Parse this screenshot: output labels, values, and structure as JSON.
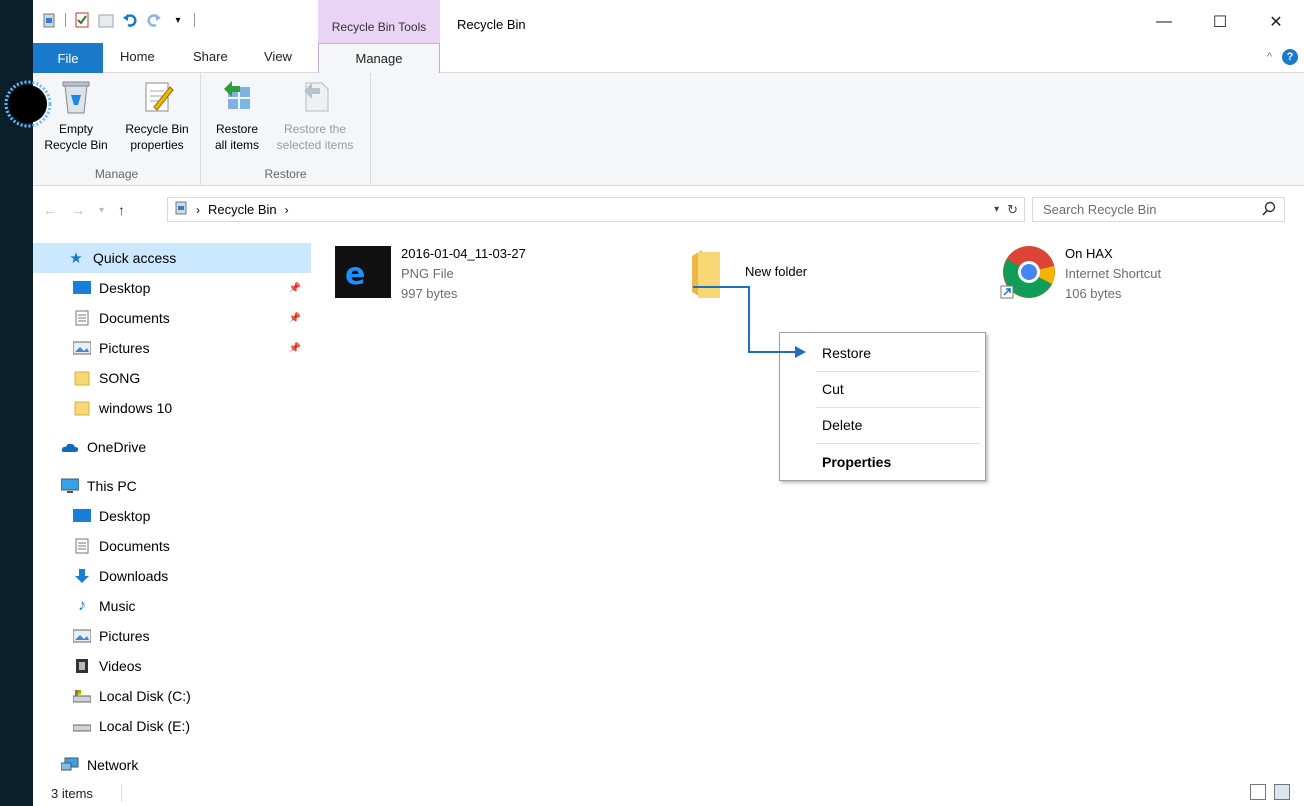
{
  "titlebar": {
    "context_tab_title": "Recycle Bin Tools",
    "window_title": "Recycle Bin",
    "minimize": "—",
    "maximize": "☐",
    "close": "✕"
  },
  "ribbon_tabs": {
    "file": "File",
    "home": "Home",
    "share": "Share",
    "view": "View",
    "manage": "Manage"
  },
  "ribbon": {
    "groups": {
      "manage": "Manage",
      "restore": "Restore"
    },
    "buttons": {
      "empty_line1": "Empty",
      "empty_line2": "Recycle Bin",
      "props_line1": "Recycle Bin",
      "props_line2": "properties",
      "restore_all_line1": "Restore",
      "restore_all_line2": "all items",
      "restore_sel_line1": "Restore the",
      "restore_sel_line2": "selected items"
    }
  },
  "address": {
    "path": "Recycle Bin",
    "search_placeholder": "Search Recycle Bin"
  },
  "nav": {
    "quick_access": "Quick access",
    "qa_desktop": "Desktop",
    "qa_documents": "Documents",
    "qa_pictures": "Pictures",
    "song": "SONG",
    "windows10": "windows 10",
    "onedrive": "OneDrive",
    "this_pc": "This PC",
    "pc_desktop": "Desktop",
    "pc_documents": "Documents",
    "pc_downloads": "Downloads",
    "pc_music": "Music",
    "pc_pictures": "Pictures",
    "pc_videos": "Videos",
    "local_c": "Local Disk (C:)",
    "local_e": "Local Disk (E:)",
    "network": "Network"
  },
  "files": [
    {
      "name": "2016-01-04_11-03-27",
      "type": "PNG File",
      "size": "997 bytes"
    },
    {
      "name": "New folder"
    },
    {
      "name": "On HAX",
      "type": "Internet Shortcut",
      "size": "106 bytes"
    }
  ],
  "context_menu": {
    "restore": "Restore",
    "cut": "Cut",
    "delete": "Delete",
    "properties": "Properties"
  },
  "status": {
    "count": "3 items"
  },
  "colors": {
    "accent": "#1979ca",
    "context_tab": "#e9d4f5",
    "selection": "#cce8ff",
    "annotation": "#1d6fc2"
  }
}
